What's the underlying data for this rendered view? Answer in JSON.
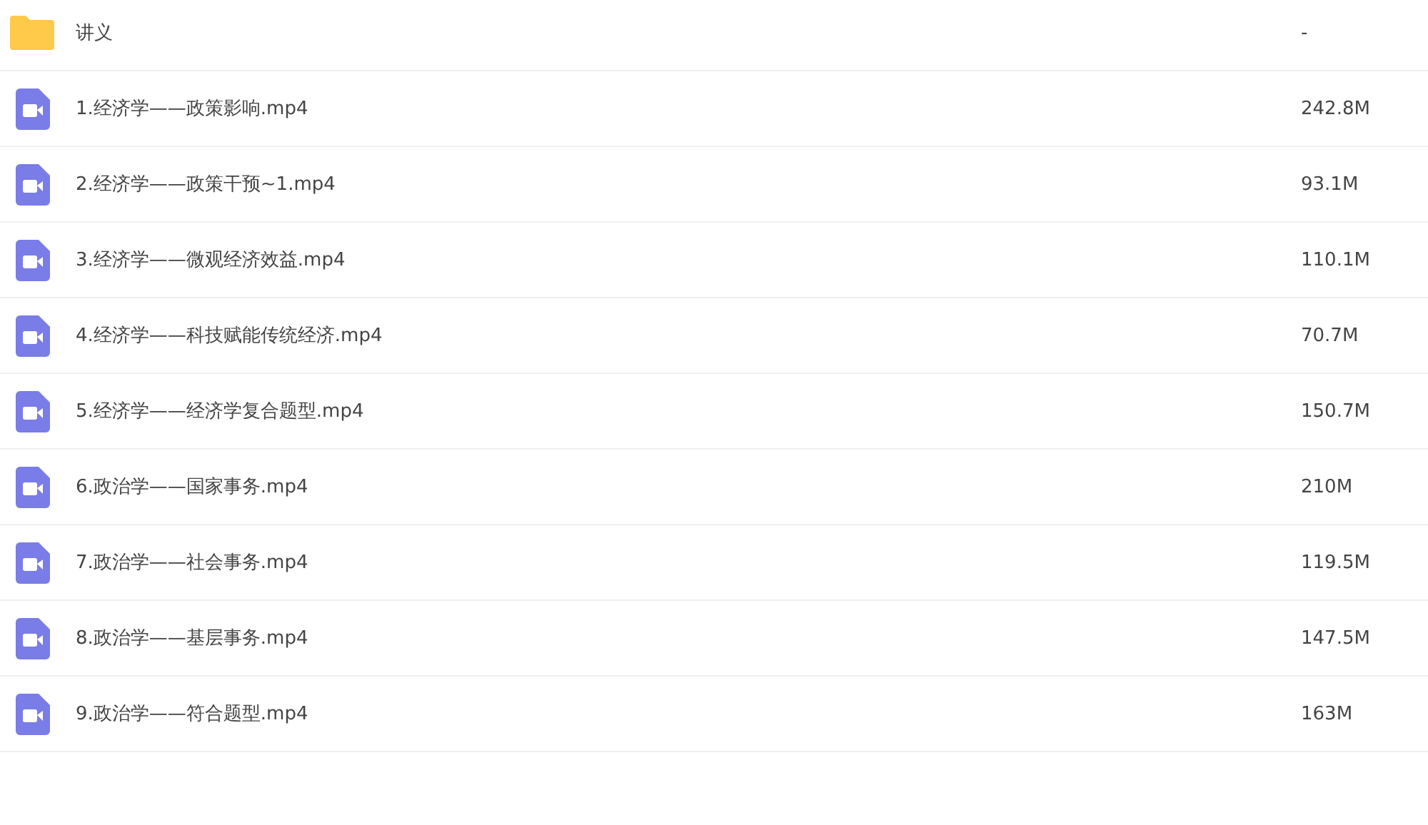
{
  "files": [
    {
      "kind": "folder",
      "name": "讲义",
      "size": "-"
    },
    {
      "kind": "video",
      "name": "1.经济学——政策影响.mp4",
      "size": "242.8M"
    },
    {
      "kind": "video",
      "name": "2.经济学——政策干预~1.mp4",
      "size": "93.1M"
    },
    {
      "kind": "video",
      "name": "3.经济学——微观经济效益.mp4",
      "size": "110.1M"
    },
    {
      "kind": "video",
      "name": "4.经济学——科技赋能传统经济.mp4",
      "size": "70.7M"
    },
    {
      "kind": "video",
      "name": "5.经济学——经济学复合题型.mp4",
      "size": "150.7M"
    },
    {
      "kind": "video",
      "name": "6.政治学——国家事务.mp4",
      "size": "210M"
    },
    {
      "kind": "video",
      "name": "7.政治学——社会事务.mp4",
      "size": "119.5M"
    },
    {
      "kind": "video",
      "name": "8.政治学——基层事务.mp4",
      "size": "147.5M"
    },
    {
      "kind": "video",
      "name": "9.政治学——符合题型.mp4",
      "size": "163M"
    }
  ]
}
